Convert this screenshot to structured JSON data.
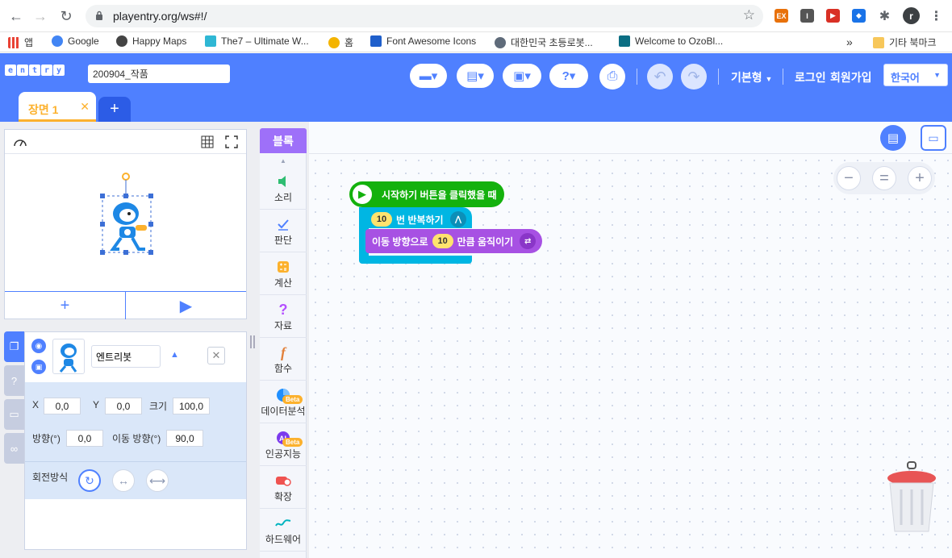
{
  "browser": {
    "url": "playentry.org/ws#!/",
    "profile_initial": "r",
    "bookmarks": [
      {
        "label": "앱",
        "color": "#e94235"
      },
      {
        "label": "Google",
        "color": "#4285f4"
      },
      {
        "label": "Happy Maps",
        "color": "#444444"
      },
      {
        "label": "The7 – Ultimate W...",
        "color": "#2fb7d4"
      },
      {
        "label": "홈",
        "color": "#f4b400"
      },
      {
        "label": "Font Awesome Icons",
        "color": "#1f5fcb"
      },
      {
        "label": "대한민국 초등로봇...",
        "color": "#5f6b7a"
      },
      {
        "label": "Welcome to OzoBl...",
        "color": "#0b6e83"
      }
    ],
    "bookmarks_overflow": "»",
    "other_bookmarks": "기타 북마크"
  },
  "header": {
    "logo_letters": [
      "e",
      "n",
      "t",
      "r",
      "y"
    ],
    "project_name": "200904_작품",
    "mode_label": "기본형",
    "login_label": "로그인",
    "signup_label": "회원가입",
    "language": "한국어",
    "scene_tab": "장면 1",
    "scene_add": "+"
  },
  "stage": {
    "add_label": "+",
    "run_label": "▶"
  },
  "object": {
    "name": "엔트리봇",
    "x_label": "X",
    "x": "0,0",
    "y_label": "Y",
    "y": "0,0",
    "size_label": "크기",
    "size": "100,0",
    "direction_label": "방향(°)",
    "direction": "0,0",
    "move_dir_label": "이동 방향(°)",
    "move_dir": "90,0",
    "rotation_label": "회전방식"
  },
  "palette": {
    "tab_label": "블록",
    "categories": [
      {
        "label": "소리",
        "icon": "speaker-icon",
        "color": "#2fbd72"
      },
      {
        "label": "판단",
        "icon": "check-icon",
        "color": "#4f80ff"
      },
      {
        "label": "계산",
        "icon": "calculator-icon",
        "color": "#fcb12d"
      },
      {
        "label": "자료",
        "icon": "question-icon",
        "color": "#b450ff"
      },
      {
        "label": "함수",
        "icon": "function-icon",
        "color": "#e2803a"
      },
      {
        "label": "데이터분석",
        "icon": "pie-chart-icon",
        "color": "#1f8fff",
        "beta": "Beta"
      },
      {
        "label": "인공지능",
        "icon": "ai-icon",
        "color": "#7c3aed",
        "beta": "Beta"
      },
      {
        "label": "확장",
        "icon": "extension-icon",
        "color": "#ef5350"
      },
      {
        "label": "하드웨어",
        "icon": "hardware-icon",
        "color": "#00b4bf"
      }
    ]
  },
  "blocks": {
    "start": "시작하기 버튼을 클릭했을 때",
    "repeat_count": "10",
    "repeat_label": "번 반복하기",
    "move_prefix": "이동 방향으로",
    "move_value": "10",
    "move_suffix": "만큼 움직이기",
    "colors": {
      "start": "#14b10d",
      "repeat": "#00b6e3",
      "move": "#a751e3"
    }
  },
  "zoom": {
    "out": "−",
    "reset": "=",
    "in": "+"
  }
}
